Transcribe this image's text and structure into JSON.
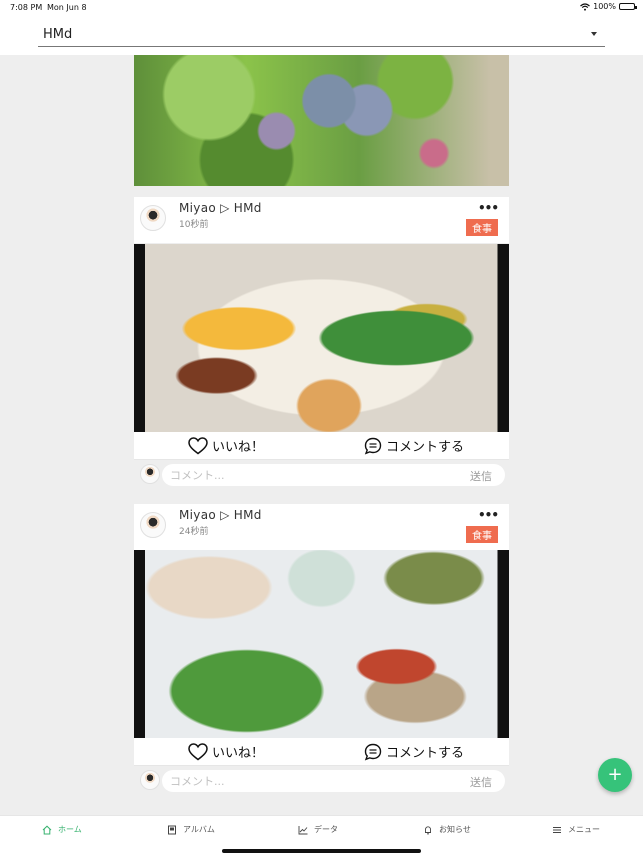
{
  "status_bar": {
    "time": "7:08 PM",
    "date": "Mon Jun 8",
    "battery": "100%",
    "battery_level": 1.0
  },
  "header": {
    "selected_group": "HMd"
  },
  "posts": [
    {
      "author": "Miyao ▷ HMd",
      "time": "10秒前",
      "tag": "食事",
      "more": "•••",
      "like_label": "いいね！",
      "comment_label": "コメントする",
      "comment_placeholder": "コメント...",
      "send_label": "送信"
    },
    {
      "author": "Miyao ▷ HMd",
      "time": "24秒前",
      "tag": "食事",
      "more": "•••",
      "like_label": "いいね！",
      "comment_label": "コメントする",
      "comment_placeholder": "コメント...",
      "send_label": "送信"
    }
  ],
  "fab_label": "+",
  "tabs": [
    {
      "label": "ホーム",
      "icon": "home-icon",
      "active": true
    },
    {
      "label": "アルバム",
      "icon": "album-icon",
      "active": false
    },
    {
      "label": "データ",
      "icon": "chart-icon",
      "active": false
    },
    {
      "label": "お知らせ",
      "icon": "bell-icon",
      "active": false
    },
    {
      "label": "メニュー",
      "icon": "menu-icon",
      "active": false
    }
  ],
  "colors": {
    "accent": "#36c37a",
    "tag": "#ef6c4f"
  }
}
